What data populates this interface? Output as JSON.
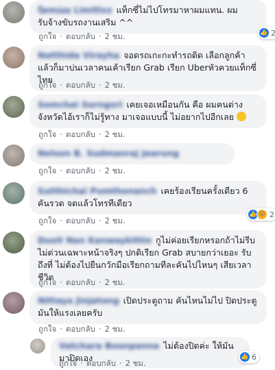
{
  "labels": {
    "like": "ถูกใจ",
    "reply": "ตอบกลับ",
    "dot": "·"
  },
  "comments": [
    {
      "name": "นิดหน่อย Limitlxx",
      "text": "แท็กซี่ไม่ไปโทรมาหาผมแทน. ผมรับจ้างขับรถงานเสริม ^^",
      "time": "2 ชม.",
      "reaction_count": "2",
      "avatar_color": "#8c8f86"
    },
    {
      "name": "Natthida Virayha",
      "text": "จอดรถเกะกะทำรถติด เลือกลูกค้าแล้วก็มาบ่นเวลาคนเค้าเรียก Grab เรียก Uberหัวควยแท็กซี่ไทย",
      "time": "2 ชม.",
      "reaction_count": "",
      "avatar_color": "#a88a7a"
    },
    {
      "name": "Somchai Sorngsri",
      "text": "เคยเจอเหมือนกัน คือ ผมคนต่างจังหวัดไอ้เราก็ไม่รู้ทาง มาเจอแบบนี้ ไม่อยากไปอีกเลย",
      "time": "2 ชม.",
      "reaction_count": "",
      "avatar_color": "#6e7a5e"
    },
    {
      "name": "Nelson B. Sudmanraj Jearung",
      "text": "",
      "time": "2 ชม.",
      "reaction_count": "",
      "avatar_color": "#9a8f88"
    },
    {
      "name": "Sutthichai Pumthonanch",
      "text": "เคยร้องเรียนครั้งเดียว 6 คันรวด จดแล้วโทรทีเดียว",
      "time": "2 ชม.",
      "reaction_count": "2",
      "avatar_color": "#6f8a7c"
    },
    {
      "name": "Dusit Nan Kanwaykittin",
      "text": "กูไม่ค่อยเรียกหรอกถ้าไม่รีบไม่ด่วนเฉพาะหน้าจริงๆ ปกติเรียก Grab สบายกว่าเยอะ รับถึงที่ ไม่ต้องไปยืนกวักมือเรียกถามทีละคันไปไหนๆ เสียเวลาชีวิต",
      "time": "2 ชม.",
      "reaction_count": "",
      "avatar_color": "#5e6f4e"
    },
    {
      "name": "Nittaya Jinjatong",
      "text": "เปิดประตูถาม คันไหนไม่ไป ปิดประตูมันให้แรงเลยครับ",
      "time": "2 ชม.",
      "reaction_count": "",
      "avatar_color": "#8a6a74"
    },
    {
      "name": "Vatchara Boonpanna",
      "text": "ไม่ต้องปิดค่ะ ให้มันมาปิดเอง",
      "time": "2 ชม.",
      "reaction_count": "6",
      "avatar_color": "#b9b0a8"
    }
  ]
}
